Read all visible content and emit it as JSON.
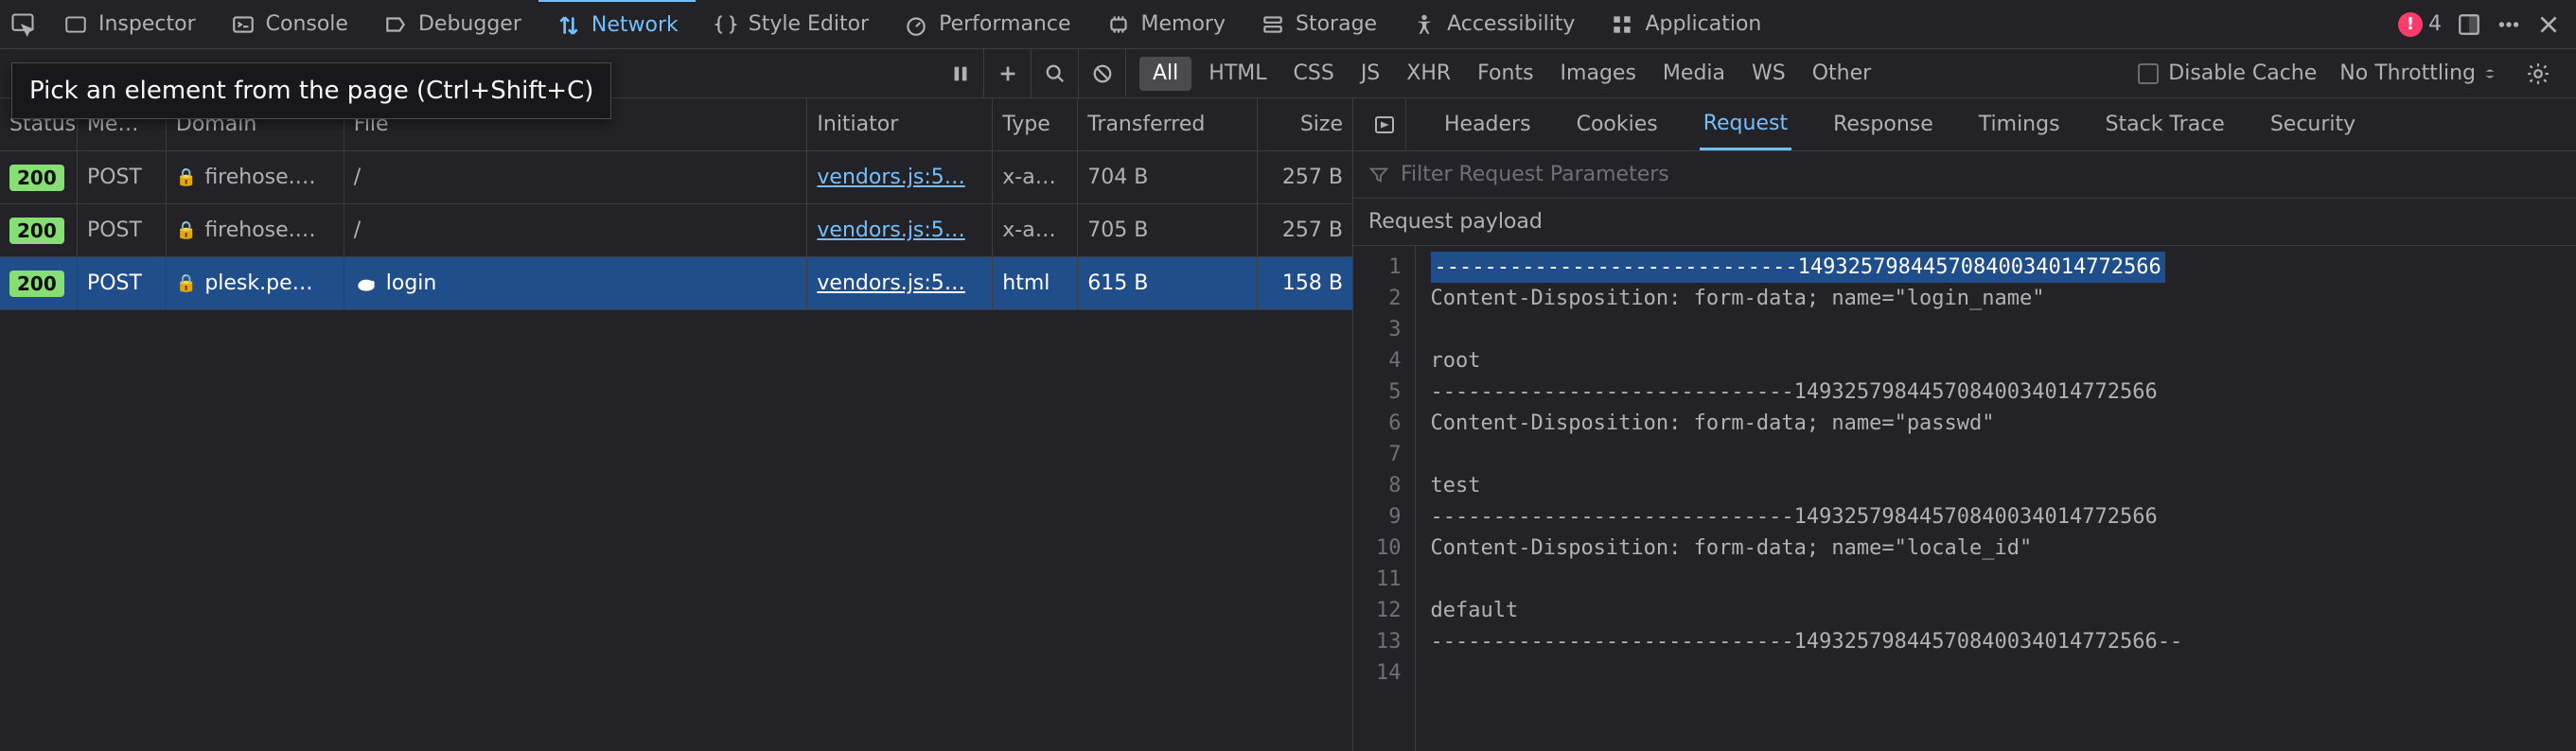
{
  "toolbar": {
    "tabs": [
      {
        "icon": "inspector-icon",
        "label": "Inspector"
      },
      {
        "icon": "console-icon",
        "label": "Console"
      },
      {
        "icon": "debugger-icon",
        "label": "Debugger"
      },
      {
        "icon": "network-icon",
        "label": "Network"
      },
      {
        "icon": "style-icon",
        "label": "Style Editor"
      },
      {
        "icon": "perf-icon",
        "label": "Performance"
      },
      {
        "icon": "memory-icon",
        "label": "Memory"
      },
      {
        "icon": "storage-icon",
        "label": "Storage"
      },
      {
        "icon": "accessibility-icon",
        "label": "Accessibility"
      },
      {
        "icon": "application-icon",
        "label": "Application"
      }
    ],
    "active_index": 3,
    "error_count": "4"
  },
  "tooltip": "Pick an element from the page (Ctrl+Shift+C)",
  "filter_bar": {
    "types": [
      "All",
      "HTML",
      "CSS",
      "JS",
      "XHR",
      "Fonts",
      "Images",
      "Media",
      "WS",
      "Other"
    ],
    "active_type": 0,
    "disable_cache_label": "Disable Cache",
    "throttling_label": "No Throttling"
  },
  "net_table": {
    "columns": {
      "status": "Status",
      "method": "Me…",
      "domain": "Domain",
      "file": "File",
      "initiator": "Initiator",
      "type": "Type",
      "transferred": "Transferred",
      "size": "Size"
    },
    "rows": [
      {
        "status": "200",
        "method": "POST",
        "domain": "firehose.…",
        "file": "/",
        "initiator": "vendors.js:5…",
        "type": "x-a…",
        "transferred": "704 B",
        "size": "257 B",
        "selected": false,
        "turtle": false
      },
      {
        "status": "200",
        "method": "POST",
        "domain": "firehose.…",
        "file": "/",
        "initiator": "vendors.js:5…",
        "type": "x-a…",
        "transferred": "705 B",
        "size": "257 B",
        "selected": false,
        "turtle": false
      },
      {
        "status": "200",
        "method": "POST",
        "domain": "plesk.pe…",
        "file": "login",
        "initiator": "vendors.js:5…",
        "type": "html",
        "transferred": "615 B",
        "size": "158 B",
        "selected": true,
        "turtle": true
      }
    ]
  },
  "details": {
    "tabs": [
      "Headers",
      "Cookies",
      "Request",
      "Response",
      "Timings",
      "Stack Trace",
      "Security"
    ],
    "active_tab": 2,
    "filter_placeholder": "Filter Request Parameters",
    "payload_label": "Request payload",
    "code_lines": [
      "-----------------------------149325798445708400340147725​66",
      "Content-Disposition: form-data; name=\"login_name\"",
      "",
      "root",
      "-----------------------------149325798445708400340147725​66",
      "Content-Disposition: form-data; name=\"passwd\"",
      "",
      "test",
      "-----------------------------149325798445708400340147725​66",
      "Content-Disposition: form-data; name=\"locale_id\"",
      "",
      "default",
      "-----------------------------149325798445708400340147725​66--",
      ""
    ],
    "highlight_line": 0
  }
}
